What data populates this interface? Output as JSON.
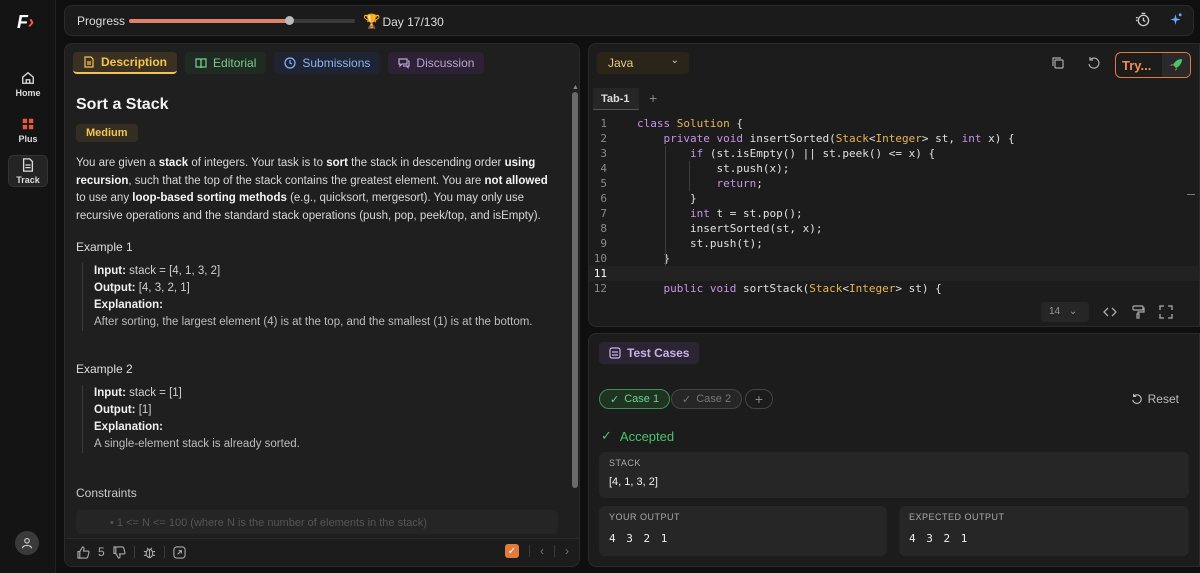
{
  "rail": {
    "logo": "F",
    "items": [
      {
        "label": "Home",
        "icon": "home-icon"
      },
      {
        "label": "Plus",
        "icon": "plus-icon"
      },
      {
        "label": "Track",
        "icon": "track-icon"
      }
    ]
  },
  "topbar": {
    "progress_label": "Progress",
    "progress_fraction": 0.71,
    "day_text": "Day 17/130"
  },
  "description": {
    "tabs": [
      {
        "label": "Description",
        "icon": "document-icon"
      },
      {
        "label": "Editorial",
        "icon": "book-icon"
      },
      {
        "label": "Submissions",
        "icon": "clock-icon"
      },
      {
        "label": "Discussion",
        "icon": "chat-icon"
      }
    ],
    "title": "Sort a Stack",
    "difficulty": "Medium",
    "statement_parts": [
      "You are given a ",
      "stack",
      " of integers. Your task is to ",
      "sort",
      " the stack in descending order ",
      "using recursion",
      ", such that the top of the stack contains the greatest element. You are ",
      "not allowed",
      " to use any ",
      "loop-based sorting methods",
      " (e.g., quicksort, mergesort). You may only use recursive operations and the standard stack operations (push, pop, peek/top, and isEmpty)."
    ],
    "examples": [
      {
        "title": "Example 1",
        "input_label": "Input:",
        "input": " stack = [4, 1, 3, 2]",
        "output_label": "Output:",
        "output": " [4, 3, 2, 1]",
        "explanation_label": "Explanation:",
        "explanation": "After sorting, the largest element (4) is at the top, and the smallest (1) is at the bottom."
      },
      {
        "title": "Example 2",
        "input_label": "Input:",
        "input": " stack = [1]",
        "output_label": "Output:",
        "output": " [1]",
        "explanation_label": "Explanation:",
        "explanation": "A single-element stack is already sorted."
      }
    ],
    "constraints_title": "Constraints",
    "constraint_1": "• 1 <= N <= 100 (where N is the number of elements in the stack)",
    "footer": {
      "likes": "5"
    }
  },
  "editor": {
    "language": "Java",
    "try_label": "Try...",
    "file_tab": "Tab-1",
    "font_size": "14",
    "code_lines": [
      {
        "n": "1",
        "t": "class Solution {"
      },
      {
        "n": "2",
        "t": "    private void insertSorted(Stack<Integer> st, int x) {"
      },
      {
        "n": "3",
        "t": "        if (st.isEmpty() || st.peek() <= x) {"
      },
      {
        "n": "4",
        "t": "            st.push(x);"
      },
      {
        "n": "5",
        "t": "            return;"
      },
      {
        "n": "6",
        "t": "        }"
      },
      {
        "n": "7",
        "t": "        int t = st.pop();"
      },
      {
        "n": "8",
        "t": "        insertSorted(st, x);"
      },
      {
        "n": "9",
        "t": "        st.push(t);"
      },
      {
        "n": "10",
        "t": "    }"
      },
      {
        "n": "11",
        "t": ""
      },
      {
        "n": "12",
        "t": "    public void sortStack(Stack<Integer> st) {"
      }
    ],
    "current_line": "11"
  },
  "tests": {
    "tab_label": "Test Cases",
    "cases": [
      "Case 1",
      "Case 2"
    ],
    "reset_label": "Reset",
    "status": "Accepted",
    "status_color": "#49c46a",
    "stack_label": "STACK",
    "stack_value": "[4, 1, 3, 2]",
    "your_output_label": "YOUR OUTPUT",
    "your_output": "4 3 2 1",
    "expected_label": "EXPECTED OUTPUT",
    "expected": "4 3 2 1"
  },
  "colors": {
    "accent": "#f5c451",
    "brand": "#e07b39"
  }
}
